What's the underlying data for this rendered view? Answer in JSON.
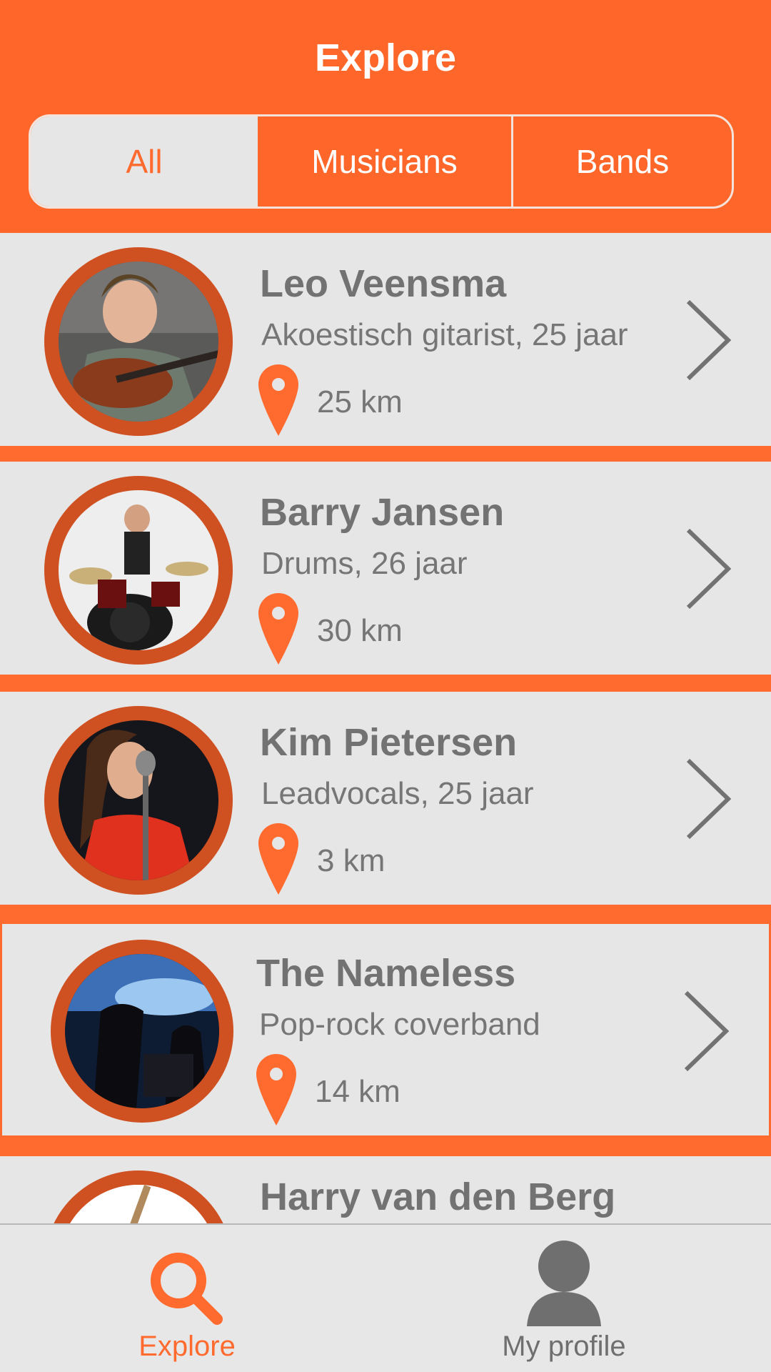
{
  "header": {
    "title": "Explore",
    "segments": [
      "All",
      "Musicians",
      "Bands"
    ],
    "selected_segment": "All"
  },
  "list": [
    {
      "name": "Leo Veensma",
      "subtitle": "Akoestisch gitarist, 25 jaar",
      "distance": "25 km"
    },
    {
      "name": "Barry Jansen",
      "subtitle": "Drums, 26 jaar",
      "distance": "30 km"
    },
    {
      "name": "Kim Pietersen",
      "subtitle": "Leadvocals, 25 jaar",
      "distance": "3 km"
    },
    {
      "name": "The Nameless",
      "subtitle": "Pop-rock coverband",
      "distance": "14 km"
    },
    {
      "name": "Harry van den Berg",
      "subtitle": "",
      "distance": ""
    }
  ],
  "tabbar": {
    "explore_label": "Explore",
    "profile_label": "My profile",
    "active": "Explore"
  },
  "icons": {
    "location": "location-pin-icon",
    "chevron": "chevron-right-icon",
    "search": "search-icon",
    "user": "user-icon"
  },
  "colors": {
    "accent": "#ff6a2e",
    "avatar_ring": "#cf5020",
    "row_background": "#e6e6e7",
    "text_gray": "#727272"
  }
}
